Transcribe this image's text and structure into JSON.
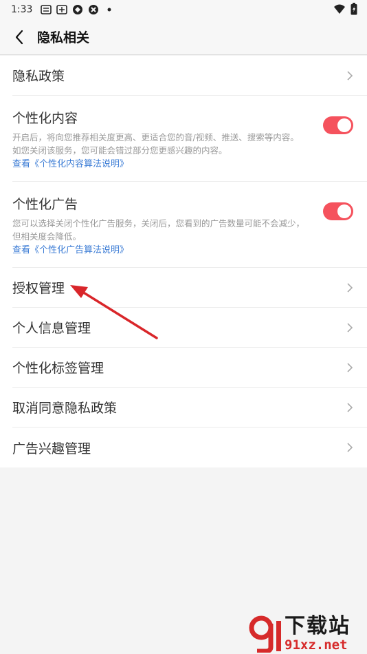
{
  "status_bar": {
    "time": "1:33",
    "icons": [
      "notification-icon",
      "notification-icon",
      "app-icon",
      "app-icon",
      "dot-icon"
    ],
    "right_icons": [
      "wifi-icon",
      "battery-icon"
    ]
  },
  "header": {
    "title": "隐私相关",
    "back_icon": "chevron-left-icon"
  },
  "items": {
    "privacy_policy": {
      "label": "隐私政策"
    },
    "personalized_content": {
      "label": "个性化内容",
      "desc": "开启后，将向您推荐相关度更高、更适合您的音/视频、推送、搜索等内容。如您关闭该服务，您可能会错过部分您更感兴趣的内容。",
      "link": "查看《个性化内容算法说明》",
      "enabled": true
    },
    "personalized_ads": {
      "label": "个性化广告",
      "desc": "您可以选择关闭个性化广告服务，关闭后，您看到的广告数量可能不会减少，但相关度会降低。",
      "link": "查看《个性化广告算法说明》",
      "enabled": true
    },
    "authorization": {
      "label": "授权管理"
    },
    "personal_info": {
      "label": "个人信息管理"
    },
    "tags": {
      "label": "个性化标签管理"
    },
    "revoke_consent": {
      "label": "取消同意隐私政策"
    },
    "ad_interest": {
      "label": "广告兴趣管理"
    }
  },
  "colors": {
    "toggle_on": "#f5525d",
    "link": "#3a7bd5",
    "annotation_arrow": "#d9262a"
  },
  "watermark": {
    "cn": "下载站",
    "en": "91xz.net"
  }
}
